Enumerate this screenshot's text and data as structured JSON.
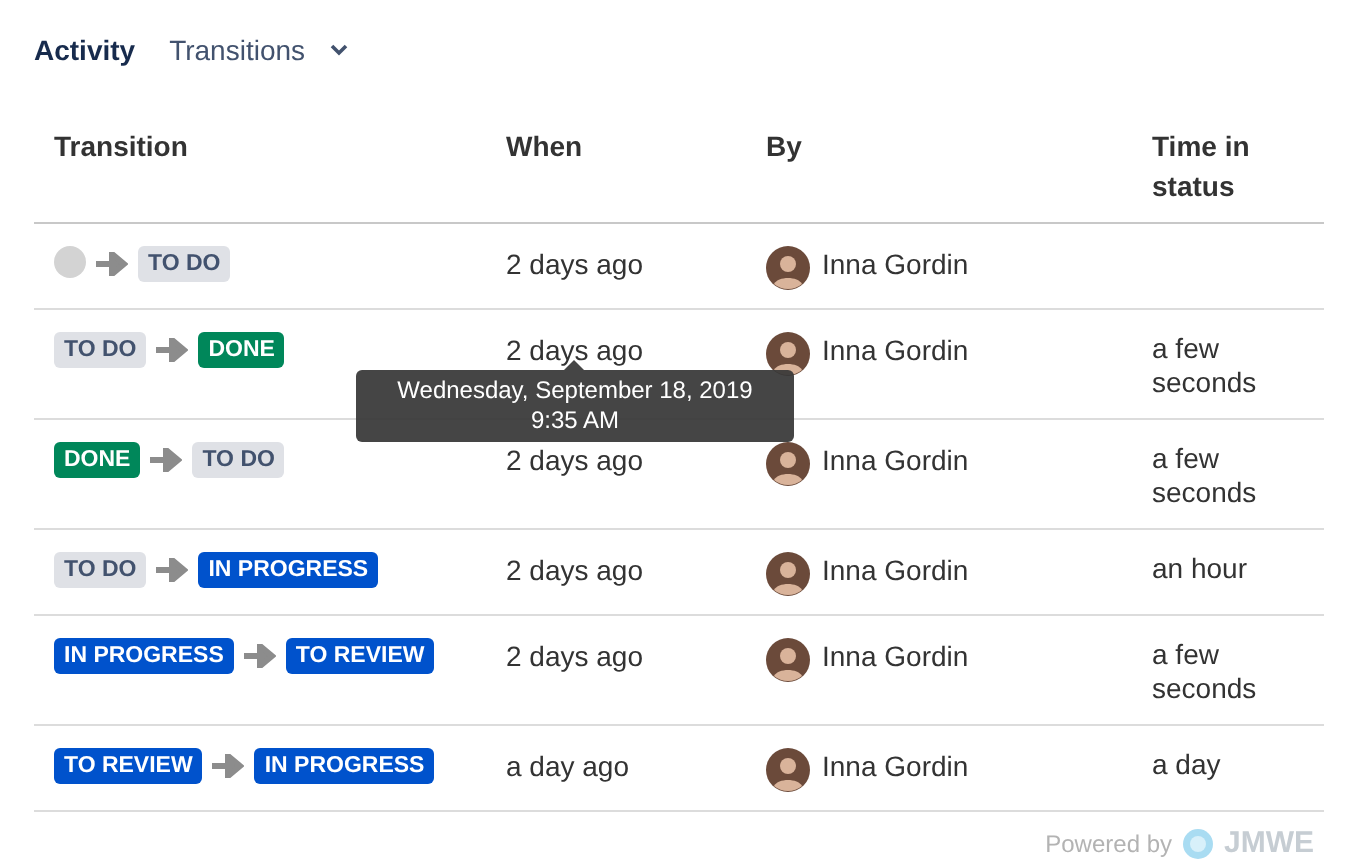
{
  "header": {
    "title": "Activity",
    "dropdown": "Transitions"
  },
  "table": {
    "columns": [
      "Transition",
      "When",
      "By",
      "Time in status"
    ],
    "rows": [
      {
        "from": {
          "kind": "none"
        },
        "to": {
          "kind": "todo",
          "label": "TO DO"
        },
        "when": "2 days ago",
        "by": "Inna Gordin"
      },
      {
        "from": {
          "kind": "todo",
          "label": "TO DO"
        },
        "to": {
          "kind": "done",
          "label": "DONE"
        },
        "when": "2 days ago",
        "by": "Inna Gordin",
        "time": "a few seconds",
        "tooltip": [
          "Wednesday, September 18, 2019",
          "9:35 AM"
        ]
      },
      {
        "from": {
          "kind": "done",
          "label": "DONE"
        },
        "to": {
          "kind": "todo",
          "label": "TO DO"
        },
        "when": "2 days ago",
        "by": "Inna Gordin",
        "time": "a few seconds"
      },
      {
        "from": {
          "kind": "todo",
          "label": "TO DO"
        },
        "to": {
          "kind": "progress",
          "label": "IN PROGRESS"
        },
        "when": "2 days ago",
        "by": "Inna Gordin",
        "time": "an hour"
      },
      {
        "from": {
          "kind": "progress",
          "label": "IN PROGRESS"
        },
        "to": {
          "kind": "progress",
          "label": "TO REVIEW"
        },
        "when": "2 days ago",
        "by": "Inna Gordin",
        "time": "a few seconds"
      },
      {
        "from": {
          "kind": "progress",
          "label": "TO REVIEW"
        },
        "to": {
          "kind": "progress",
          "label": "IN PROGRESS"
        },
        "when": "a day ago",
        "by": "Inna Gordin",
        "time": "a day"
      }
    ]
  },
  "footer": {
    "powered_by": "Powered by",
    "brand": "JMWE"
  }
}
